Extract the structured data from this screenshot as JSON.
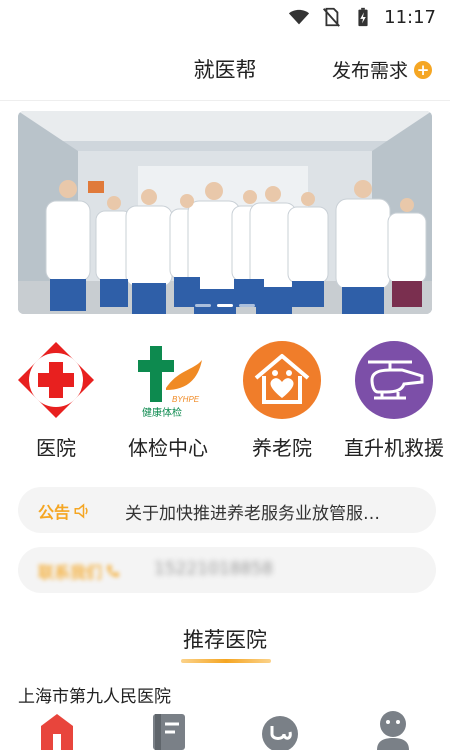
{
  "status_bar": {
    "time": "11:17",
    "icons": [
      "wifi-icon",
      "no-sim-icon",
      "battery-charging-icon"
    ]
  },
  "header": {
    "title": "就医帮",
    "publish_label": "发布需求",
    "publish_icon": "plus-circle-icon"
  },
  "banner": {
    "description_icon": "doctors-group-image",
    "slides": 3,
    "active_slide": 1
  },
  "categories": [
    {
      "label": "医院",
      "icon": "hospital-cross-icon",
      "color": "#e8201f"
    },
    {
      "label": "体检中心",
      "icon": "health-checkup-logo-icon",
      "color": "#0d8a4f"
    },
    {
      "label": "养老院",
      "icon": "nursing-home-icon",
      "color": "#f07d2a"
    },
    {
      "label": "直升机救援",
      "icon": "helicopter-icon",
      "color": "#7c4fa8"
    }
  ],
  "notice": {
    "tag": "公告",
    "icon": "speaker-icon",
    "text": "关于加快推进养老服务业放管服…"
  },
  "contact": {
    "tag": "联系我们",
    "icon": "phone-icon",
    "text": "15221018858"
  },
  "recommend": {
    "title": "推荐医院",
    "hospital_name": "上海市第九人民医院"
  },
  "accent_color": "#f5a623"
}
